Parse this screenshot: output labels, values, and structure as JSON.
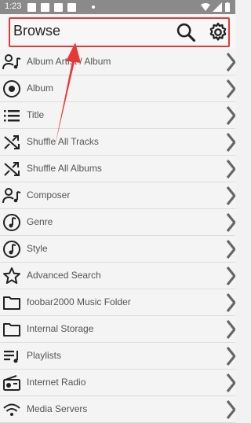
{
  "status_bar": {
    "time": "1:23"
  },
  "app_bar": {
    "title": "Browse",
    "search_icon": "search-icon",
    "settings_icon": "gear-icon"
  },
  "items": [
    {
      "label": "Album Artist / Album",
      "icon": "person-music-icon"
    },
    {
      "label": "Album",
      "icon": "album-disc-icon"
    },
    {
      "label": "Title",
      "icon": "list-icon"
    },
    {
      "label": "Shuffle All Tracks",
      "icon": "shuffle-icon"
    },
    {
      "label": "Shuffle All Albums",
      "icon": "shuffle-icon"
    },
    {
      "label": "Composer",
      "icon": "person-music-icon"
    },
    {
      "label": "Genre",
      "icon": "note-circle-icon"
    },
    {
      "label": "Style",
      "icon": "note-circle-icon"
    },
    {
      "label": "Advanced Search",
      "icon": "star-icon"
    },
    {
      "label": "foobar2000 Music Folder",
      "icon": "folder-icon"
    },
    {
      "label": "Internal Storage",
      "icon": "folder-icon"
    },
    {
      "label": "Playlists",
      "icon": "playlist-icon"
    },
    {
      "label": "Internet Radio",
      "icon": "radio-icon"
    },
    {
      "label": "Media Servers",
      "icon": "wifi-icon"
    }
  ],
  "colors": {
    "highlight": "#e53935"
  }
}
